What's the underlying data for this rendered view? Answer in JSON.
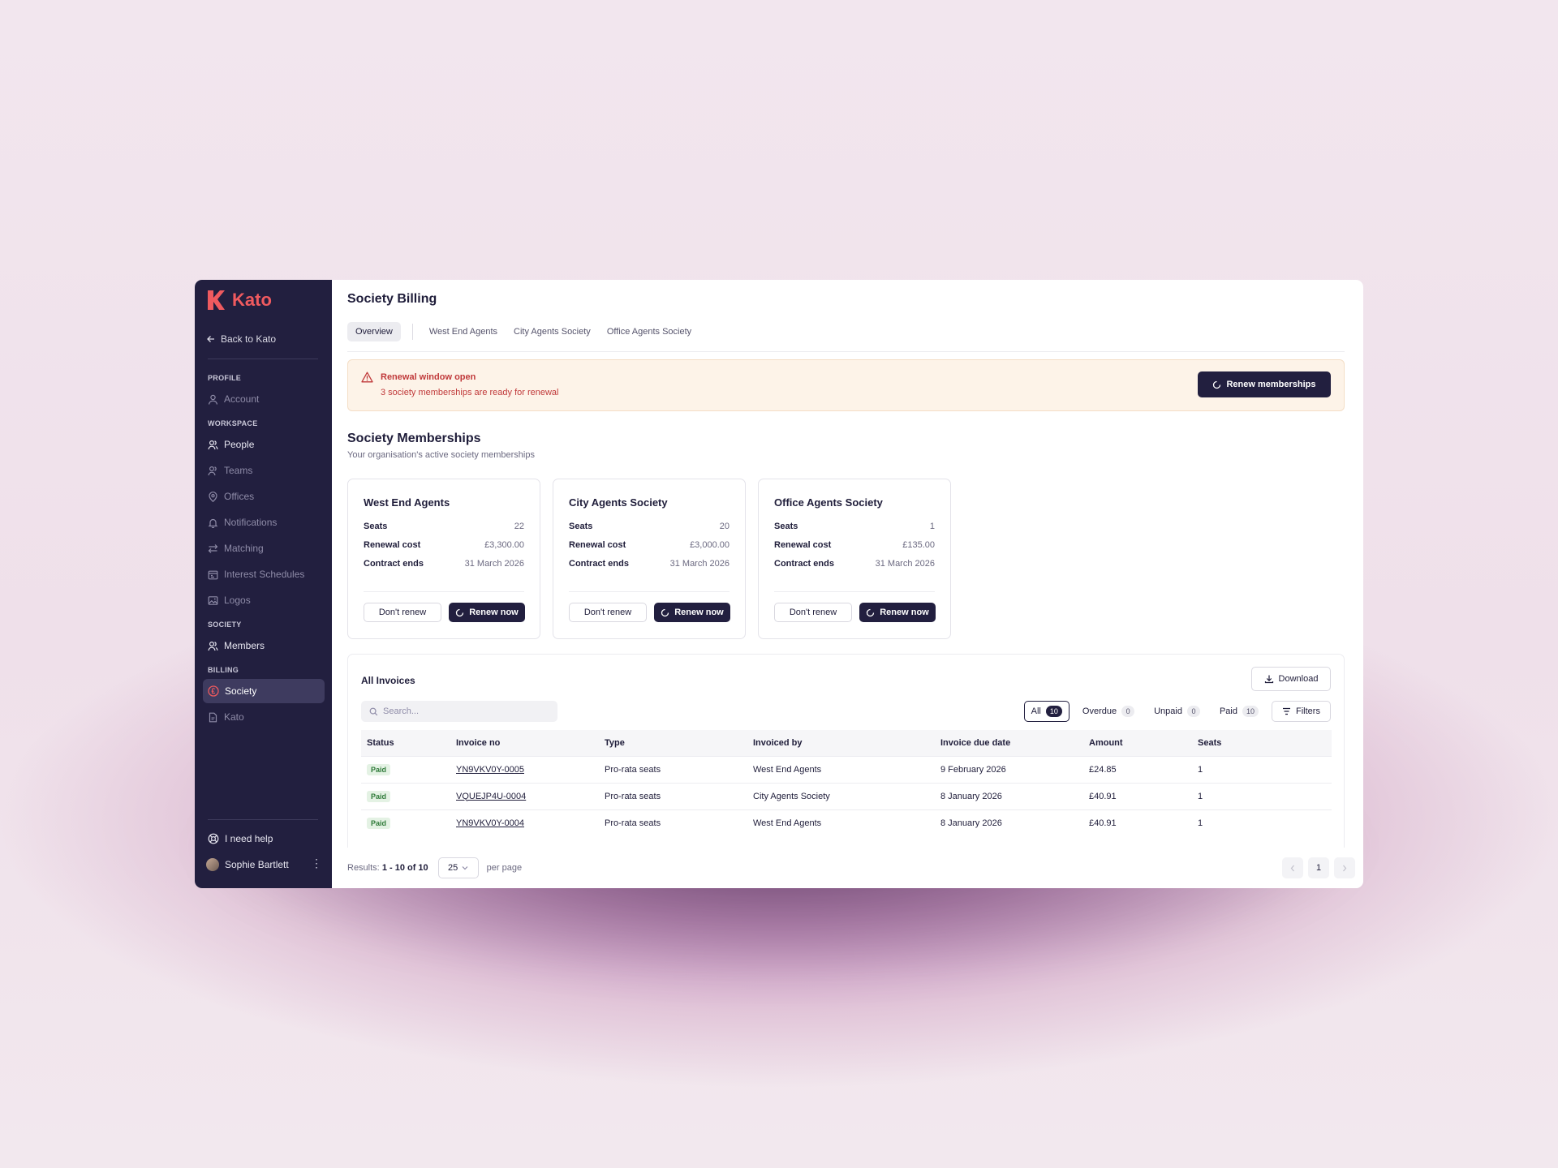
{
  "app": {
    "name": "Kato",
    "brand_color": "#ef5a5f",
    "sidebar_color": "#221f3f"
  },
  "sidebar": {
    "back_label": "Back to Kato",
    "sections": {
      "profile": "PROFILE",
      "workspace": "WORKSPACE",
      "society": "SOCIETY",
      "billing": "BILLING"
    },
    "items": {
      "account": "Account",
      "people": "People",
      "teams": "Teams",
      "offices": "Offices",
      "notifications": "Notifications",
      "matching": "Matching",
      "interest_schedules": "Interest Schedules",
      "logos": "Logos",
      "members": "Members",
      "society": "Society",
      "kato": "Kato"
    },
    "help_label": "I need help",
    "user_name": "Sophie Bartlett"
  },
  "page": {
    "title": "Society Billing",
    "tabs": [
      "Overview",
      "West End Agents",
      "City Agents Society",
      "Office Agents Society"
    ]
  },
  "alert": {
    "title": "Renewal window open",
    "subtitle": "3 society memberships are ready for renewal",
    "button": "Renew memberships"
  },
  "memberships": {
    "title": "Society Memberships",
    "subtitle": "Your organisation's active society memberships",
    "labels": {
      "seats": "Seats",
      "renewal_cost": "Renewal cost",
      "contract_ends": "Contract ends",
      "dont_renew": "Don't renew",
      "renew_now": "Renew now"
    },
    "cards": [
      {
        "name": "West End Agents",
        "seats": "22",
        "renewal_cost": "£3,300.00",
        "contract_ends": "31 March 2026"
      },
      {
        "name": "City Agents Society",
        "seats": "20",
        "renewal_cost": "£3,000.00",
        "contract_ends": "31 March 2026"
      },
      {
        "name": "Office Agents Society",
        "seats": "1",
        "renewal_cost": "£135.00",
        "contract_ends": "31 March 2026"
      }
    ]
  },
  "invoices": {
    "title": "All Invoices",
    "download_label": "Download",
    "search_placeholder": "Search...",
    "filters": [
      {
        "label": "All",
        "count": "10"
      },
      {
        "label": "Overdue",
        "count": "0"
      },
      {
        "label": "Unpaid",
        "count": "0"
      },
      {
        "label": "Paid",
        "count": "10"
      }
    ],
    "filters_button": "Filters",
    "columns": [
      "Status",
      "Invoice no",
      "Type",
      "Invoiced by",
      "Invoice due date",
      "Amount",
      "Seats"
    ],
    "rows": [
      {
        "status": "Paid",
        "invoice_no": "YN9VKV0Y-0005",
        "type": "Pro-rata seats",
        "invoiced_by": "West End Agents",
        "due_date": "9 February 2026",
        "amount": "£24.85",
        "seats": "1"
      },
      {
        "status": "Paid",
        "invoice_no": "VQUEJP4U-0004",
        "type": "Pro-rata seats",
        "invoiced_by": "City Agents Society",
        "due_date": "8 January 2026",
        "amount": "£40.91",
        "seats": "1"
      },
      {
        "status": "Paid",
        "invoice_no": "YN9VKV0Y-0004",
        "type": "Pro-rata seats",
        "invoiced_by": "West End Agents",
        "due_date": "8 January 2026",
        "amount": "£40.91",
        "seats": "1"
      }
    ]
  },
  "pagination": {
    "results_prefix": "Results:",
    "results_range": "1 - 10 of 10",
    "per_page_value": "25",
    "per_page_label": "per page",
    "current_page": "1"
  }
}
